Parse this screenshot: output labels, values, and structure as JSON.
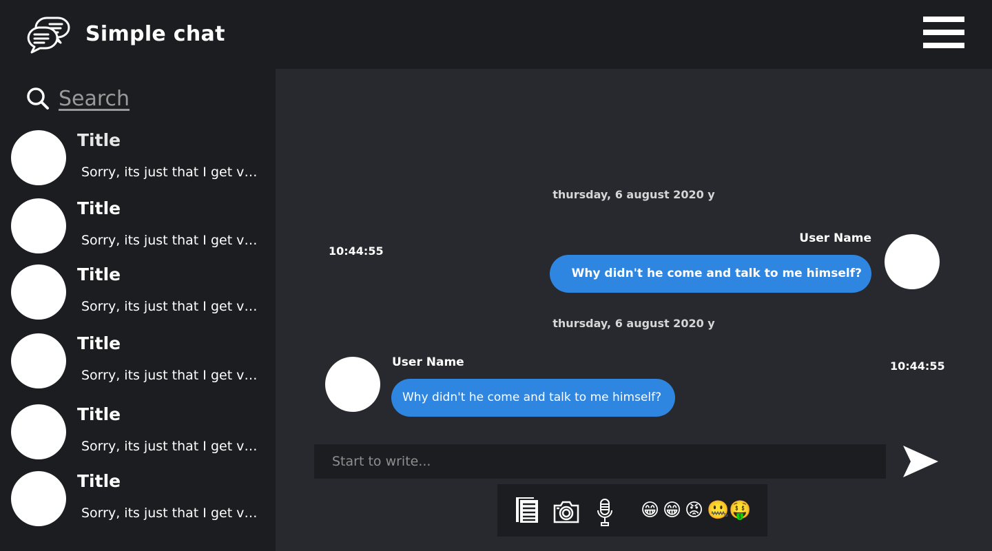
{
  "app": {
    "title": "Simple chat"
  },
  "search": {
    "placeholder": "Search"
  },
  "contacts": [
    {
      "title": "Title",
      "preview": "Sorry, its just that I get very nervous around you."
    },
    {
      "title": "Title",
      "preview": "Sorry, its just that I get very nervous around you."
    },
    {
      "title": "Title",
      "preview": "Sorry, its just that I get very nervous around you."
    },
    {
      "title": "Title",
      "preview": "Sorry, its just that I get very nervous around you."
    },
    {
      "title": "Title",
      "preview": "Sorry, its just that I get very nervous around you."
    },
    {
      "title": "Title",
      "preview": "Sorry, its just that I get very nervous around you."
    }
  ],
  "messages": [
    {
      "date": "thursday, 6 august 2020 y",
      "user": "User Name",
      "time": "10:44:55",
      "text": "Why didn't he come and talk to me himself?",
      "direction": "outgoing"
    },
    {
      "date": "thursday, 6 august 2020 y",
      "user": "User Name",
      "time": "10:44:55",
      "text": "Why didn't he come and talk to me himself?",
      "direction": "incoming"
    }
  ],
  "composer": {
    "placeholder": "Start to write..."
  },
  "toolbar": {
    "icons": [
      "document-icon",
      "camera-icon",
      "microphone-icon"
    ],
    "emojis": [
      "😁",
      "😁",
      "😡",
      "🤐",
      "🤑"
    ]
  },
  "colors": {
    "background": "#1c1d21",
    "chat_background": "#28292e",
    "bubble": "#2e86e0",
    "text": "#ffffff"
  }
}
